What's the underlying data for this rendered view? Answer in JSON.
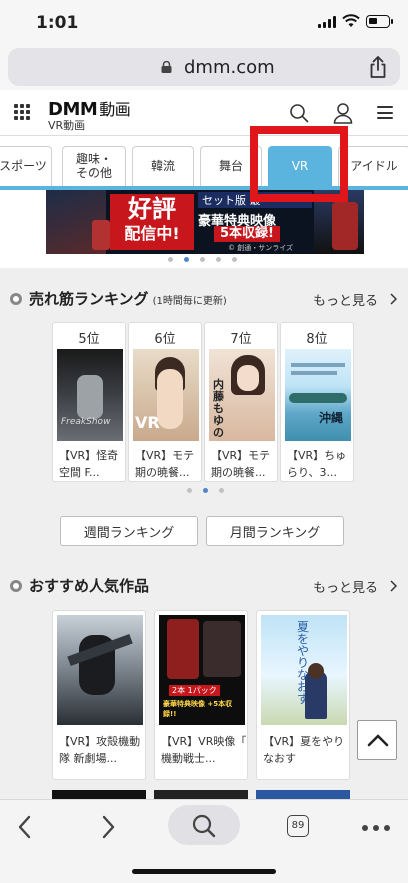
{
  "status_bar": {
    "time": "1:01"
  },
  "browser": {
    "url": "dmm.com"
  },
  "header": {
    "logo": "DMM",
    "logo_suffix": "動画",
    "logo_sub": "VR動画"
  },
  "tabs": [
    {
      "label": "スポーツ"
    },
    {
      "label": "趣味・\nその他"
    },
    {
      "label": "韓流"
    },
    {
      "label": "舞台"
    },
    {
      "label": "VR",
      "active": true
    },
    {
      "label": "アイドル"
    }
  ],
  "banner": {
    "headline_1": "好評",
    "headline_2": "配信中!",
    "set_label": "セット版 最",
    "text_1": "豪華特典映像",
    "text_2": "5本収録!",
    "copyright": "© 創通・サンライズ"
  },
  "ranking": {
    "title": "売れ筋ランキング",
    "note": "(1時間毎に更新)",
    "more": "もっと見る",
    "items": [
      {
        "rank": "5位",
        "caption": "【VR】怪奇\n空間 F..."
      },
      {
        "rank": "6位",
        "caption": "【VR】モテ\n期の暁餐..."
      },
      {
        "rank": "7位",
        "caption": "【VR】モテ\n期の暁餐..."
      },
      {
        "rank": "8位",
        "caption": "【VR】ちゅ\nらり、3..."
      }
    ],
    "thumb_texts": [
      "FreakShow",
      "VR",
      "内藤もゆの",
      "沖縄"
    ],
    "weekly_button": "週間ランキング",
    "monthly_button": "月間ランキング"
  },
  "recommended": {
    "title": "おすすめ人気作品",
    "more": "もっと見る",
    "items": [
      {
        "caption": "【VR】攻殻機動\n隊 新劇場..."
      },
      {
        "caption": "【VR】VR映像「\n機動戦士..."
      },
      {
        "caption": "【VR】夏をやり\nなおす"
      }
    ],
    "thumb_texts": [
      "2本 1パック",
      "豪華特典映像 +5本収録!!",
      "夏をやりなおす"
    ]
  },
  "toolbar": {
    "tab_count": "89"
  },
  "colors": {
    "accent": "#5ab4de",
    "highlight": "#e0161b",
    "banner_red": "#c8161d"
  }
}
